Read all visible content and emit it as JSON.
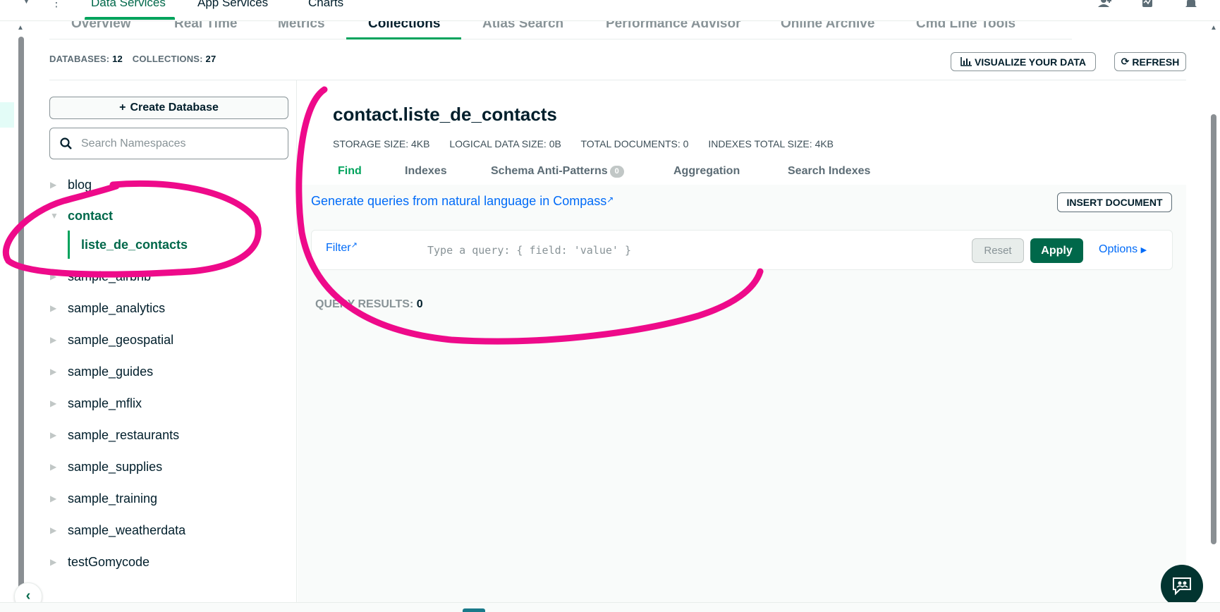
{
  "top_nav": {
    "tabs": [
      "Data Services",
      "App Services",
      "Charts"
    ],
    "active_tab": "Data Services"
  },
  "sub_tabs": {
    "items": [
      "Overview",
      "Real Time",
      "Metrics",
      "Collections",
      "Atlas Search",
      "Performance Advisor",
      "Online Archive",
      "Cmd Line Tools"
    ],
    "active": "Collections"
  },
  "stats_bar": {
    "databases_label": "DATABASES:",
    "databases_value": "12",
    "collections_label": "COLLECTIONS:",
    "collections_value": "27",
    "visualize_label": "VISUALIZE YOUR DATA",
    "refresh_label": "REFRESH"
  },
  "sidebar": {
    "create_database_label": "Create Database",
    "search_placeholder": "Search Namespaces",
    "databases": [
      "blog",
      "contact",
      "sample_airbnb",
      "sample_analytics",
      "sample_geospatial",
      "sample_guides",
      "sample_mflix",
      "sample_restaurants",
      "sample_supplies",
      "sample_training",
      "sample_weatherdata",
      "testGomycode"
    ],
    "expanded_database": "contact",
    "selected_collection": "liste_de_contacts"
  },
  "collection": {
    "namespace": "contact.liste_de_contacts",
    "storage_size_label": "STORAGE SIZE:",
    "storage_size": "4KB",
    "logical_size_label": "LOGICAL DATA SIZE:",
    "logical_size": "0B",
    "total_docs_label": "TOTAL DOCUMENTS:",
    "total_docs": "0",
    "indexes_size_label": "INDEXES TOTAL SIZE:",
    "indexes_size": "4KB",
    "tabs": [
      "Find",
      "Indexes",
      "Schema Anti-Patterns",
      "Aggregation",
      "Search Indexes"
    ],
    "active_tab": "Find",
    "schema_badge": "0"
  },
  "query": {
    "compass_link": "Generate queries from natural language in Compass",
    "insert_label": "INSERT DOCUMENT",
    "filter_label": "Filter",
    "query_placeholder": "Type a query: { field: 'value' }",
    "reset_label": "Reset",
    "apply_label": "Apply",
    "options_label": "Options",
    "results_label": "QUERY RESULTS:",
    "results_value": "0"
  },
  "colors": {
    "accent_green": "#00a35c",
    "dark_green": "#00684a",
    "link_blue": "#016bf8",
    "annotation_pink": "#ee0a8a"
  }
}
